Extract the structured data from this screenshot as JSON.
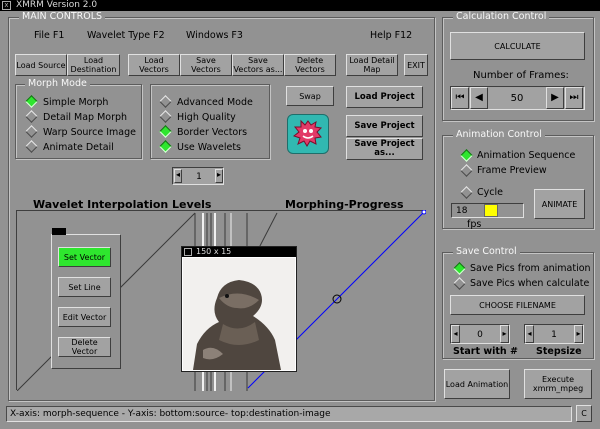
{
  "window": {
    "title": "XMRM Version 2.0",
    "close_glyph": "x"
  },
  "main_controls": {
    "legend": "MAIN CONTROLS",
    "menu": [
      {
        "label": "File F1"
      },
      {
        "label": "Wavelet Type F2"
      },
      {
        "label": "Windows F3"
      },
      {
        "label": "Help F12"
      }
    ],
    "buttons": {
      "load_source": "Load Source",
      "load_destination": "Load Destination",
      "load_vectors": "Load Vectors",
      "save_vectors": "Save Vectors",
      "save_vectors_as": "Save Vectors as...",
      "delete_vectors": "Delete Vectors",
      "load_detail_map": "Load Detail Map",
      "exit": "EXIT",
      "swap": "Swap",
      "load_project": "Load Project",
      "save_project": "Save Project",
      "save_project_as": "Save Project as..."
    }
  },
  "morph_mode": {
    "legend": "Morph Mode",
    "options": [
      {
        "label": "Simple Morph",
        "selected": true
      },
      {
        "label": "Detail Map Morph",
        "selected": false
      },
      {
        "label": "Warp Source Image",
        "selected": false
      },
      {
        "label": "Animate Detail",
        "selected": false
      }
    ]
  },
  "options_panel": {
    "options": [
      {
        "label": "Advanced Mode",
        "checked": false
      },
      {
        "label": "High Quality",
        "checked": false
      },
      {
        "label": "Border Vectors",
        "checked": true
      },
      {
        "label": "Use Wavelets",
        "checked": true
      }
    ]
  },
  "level_spinner": {
    "value": "1"
  },
  "wavelet": {
    "title": "Wavelet Interpolation Levels"
  },
  "progress": {
    "title": "Morphing-Progress"
  },
  "vector_tools": {
    "set_vector": "Set Vector",
    "set_line": "Set Line",
    "edit_vector": "Edit Vector",
    "delete_vector": "Delete Vector",
    "active_color": "#2ee62e"
  },
  "preview": {
    "title": "150 x 15"
  },
  "calculation": {
    "legend": "Calculation Control",
    "calculate": "CALCULATE",
    "frames_label": "Number of Frames:",
    "frames_value": "50"
  },
  "animation": {
    "legend": "Animation Control",
    "options": [
      {
        "label": "Animation Sequence",
        "selected": true
      },
      {
        "label": "Frame Preview",
        "selected": false
      },
      {
        "label": "Cycle",
        "selected": false
      }
    ],
    "fps_value": "18",
    "fps_label": "fps",
    "fps_level": 0.3,
    "animate": "ANIMATE"
  },
  "save": {
    "legend": "Save Control",
    "options": [
      {
        "label": "Save Pics from animation",
        "selected": true
      },
      {
        "label": "Save Pics when calculate",
        "selected": false
      }
    ],
    "choose_filename": "CHOOSE FILENAME",
    "start_value": "0",
    "start_label": "Start with #",
    "step_value": "1",
    "step_label": "Stepsize"
  },
  "bottom_buttons": {
    "load_animation": "Load Animation",
    "execute": "Execute xmrm_mpeg"
  },
  "status": {
    "text": "X-axis: morph-sequence  -  Y-axis: bottom:source-  top:destination-image",
    "c_button": "C"
  },
  "colors": {
    "accent_green": "#2ee62e",
    "fps_yellow": "#ffff00",
    "plot_line": "#0000ff",
    "logo_red": "#e23a68",
    "logo_teal": "#31b8b1"
  }
}
